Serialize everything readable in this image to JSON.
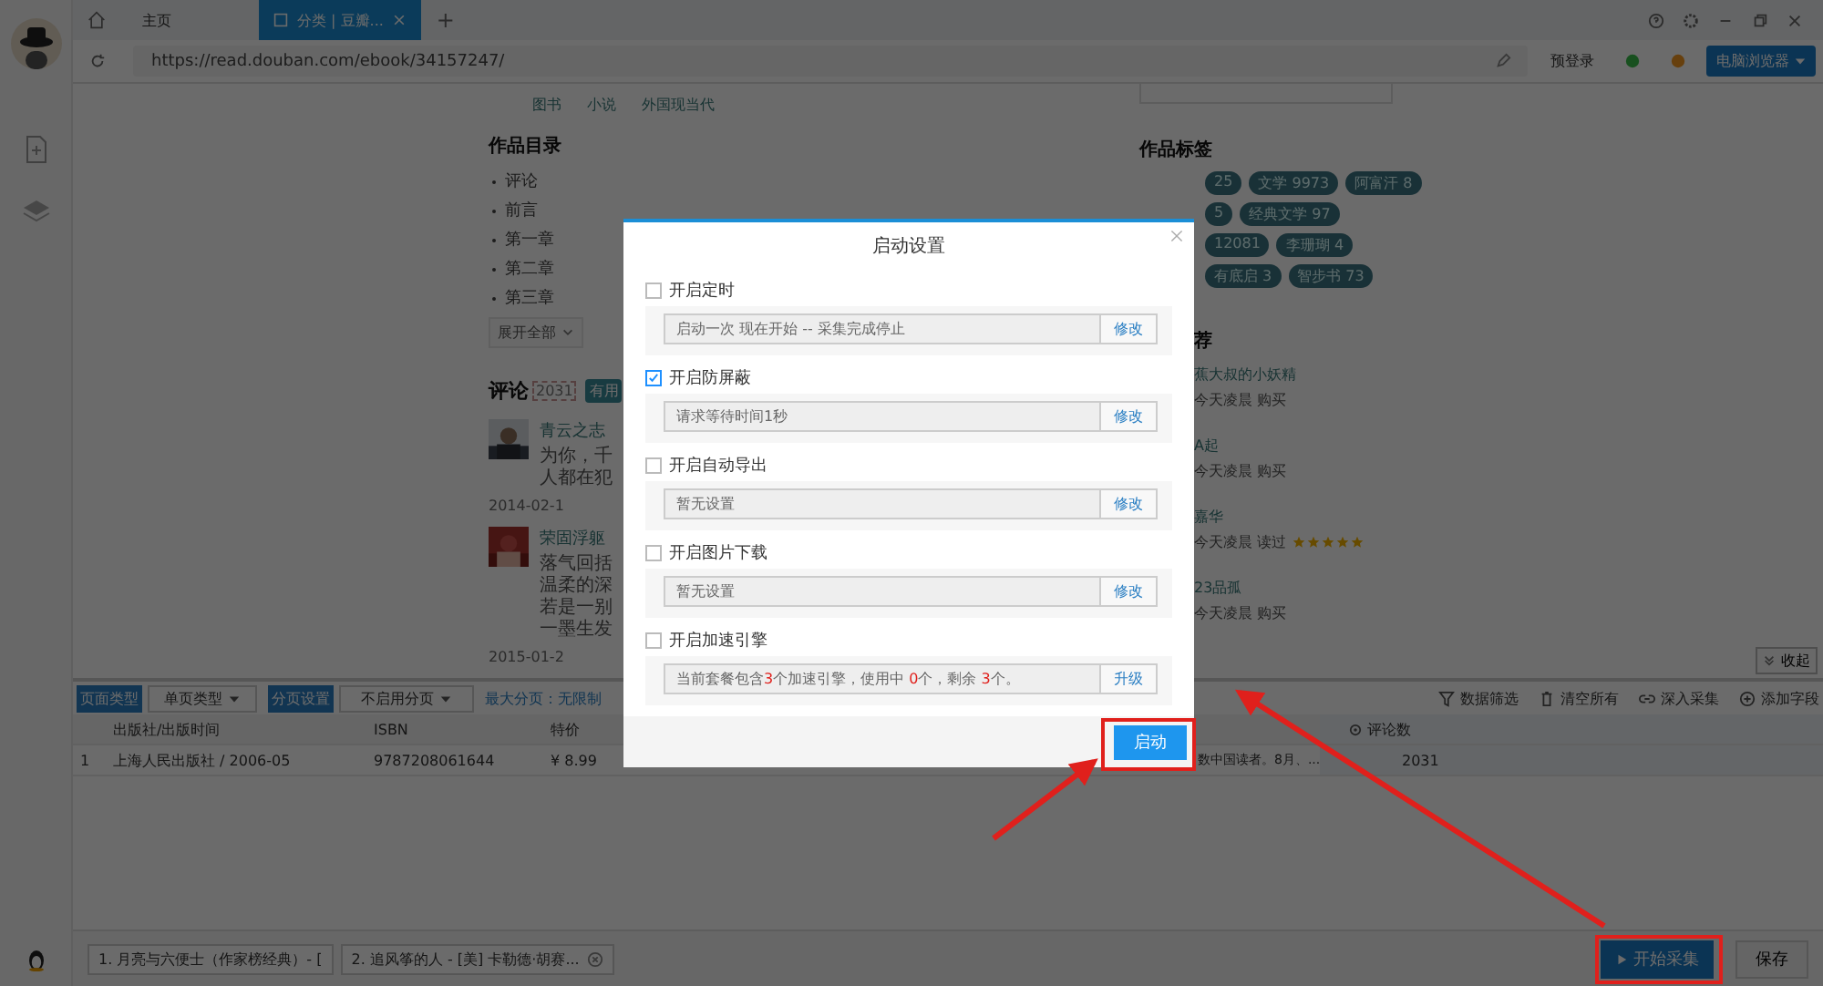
{
  "tabs": [
    {
      "label": "主页",
      "selected": false
    },
    {
      "label": "分类 | 豆瓣...",
      "selected": true
    }
  ],
  "new_tab": "+",
  "address_bar": {
    "url": "https://read.douban.com/ebook/34157247/",
    "login": "预登录",
    "browser_mode": "电脑浏览器"
  },
  "page": {
    "breadcrumb": [
      "图书",
      "小说",
      "外国现当代"
    ],
    "catalog": {
      "title": "作品目录",
      "items": [
        "评论",
        "前言",
        "第一章",
        "第二章",
        "第三章"
      ],
      "expand": "展开全部"
    },
    "comments": {
      "title": "评论",
      "count": "2031",
      "filter": "有用",
      "items": [
        {
          "name": "青云之志",
          "lines": [
            "为你，千",
            "人都在犯"
          ],
          "date": "2014-02-1"
        },
        {
          "name": "荣固浮躯",
          "lines": [
            "落气回括",
            "温柔的深",
            "若是一别",
            "一墨生发"
          ],
          "date": "2015-01-2"
        }
      ]
    },
    "tags": {
      "title": "作品标签",
      "rows": [
        [
          "25",
          "文学 9973",
          "阿富汗 8"
        ],
        [
          "5",
          "经典文学 97"
        ],
        [
          "12081",
          "李珊瑚 4"
        ],
        [
          "有底启 3",
          "智步书 73"
        ]
      ]
    },
    "readers": {
      "heading": "荐",
      "items": [
        {
          "name": "蕉大叔的小妖精",
          "activity": "今天凌晨 购买"
        },
        {
          "name": "A起",
          "activity": "今天凌晨 购买"
        },
        {
          "name": "嘉华",
          "activity": "今天凌晨 读过",
          "stars": 5
        },
        {
          "name": "23品孤",
          "activity": "今天凌晨 购买"
        }
      ]
    },
    "collapse": "收起"
  },
  "panel": {
    "page_type_label": "页面类型",
    "page_type": "单页类型",
    "paging_label": "分页设置",
    "paging": "不启用分页",
    "max_pages": "最大分页：无限制",
    "actions": [
      {
        "label": "数据筛选",
        "kind": "filter"
      },
      {
        "label": "清空所有",
        "kind": "clear"
      },
      {
        "label": "深入采集",
        "kind": "link"
      },
      {
        "label": "添加字段",
        "kind": "add"
      }
    ],
    "table": {
      "columns": [
        "出版社/出版时间",
        "ISBN",
        "特价",
        "",
        "评论数"
      ],
      "rows": [
        {
          "index": "1",
          "cells": [
            "上海人民出版社 / 2006-05",
            "9787208061644",
            "¥ 8.99",
            "数中国读者。8月、...",
            "2031"
          ]
        }
      ]
    }
  },
  "dialog": {
    "title": "启动设置",
    "options": [
      {
        "label": "开启定时",
        "checked": false,
        "value": "启动一次 现在开始 -- 采集完成停止",
        "action": "修改"
      },
      {
        "label": "开启防屏蔽",
        "checked": true,
        "value": "请求等待时间1秒",
        "action": "修改"
      },
      {
        "label": "开启自动导出",
        "checked": false,
        "value": "暂无设置",
        "action": "修改"
      },
      {
        "label": "开启图片下载",
        "checked": false,
        "value": "暂无设置",
        "action": "修改"
      },
      {
        "label": "开启加速引擎",
        "checked": false,
        "value": "当前套餐包含**3**个加速引擎，使用中 **0**个，剩余 **3**个。",
        "action": "升级"
      }
    ],
    "submit": "启动"
  },
  "taskbar": {
    "tasks": [
      "1. 月亮与六便士（作家榜经典）- [",
      "2. 追风筝的人 - [美] 卡勒德·胡赛..."
    ],
    "start": "开始采集",
    "save": "保存"
  }
}
